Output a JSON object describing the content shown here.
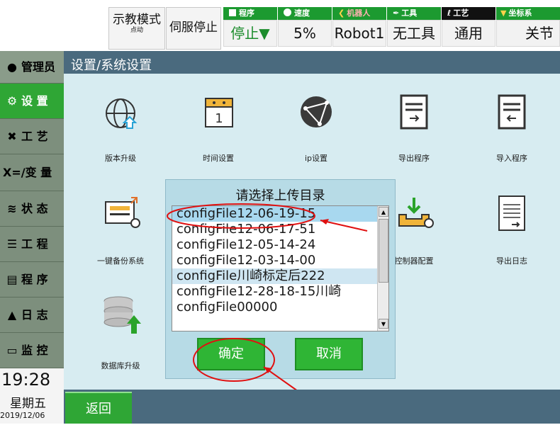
{
  "topbar": {
    "mode": {
      "label": "示教模式",
      "sub": "点动"
    },
    "servo_label": "伺服停止",
    "status": [
      {
        "header": "程序",
        "value": "停止▼",
        "color": "#1c8c2c",
        "icon": "grid-icon"
      },
      {
        "header": "速度",
        "value": "5%",
        "color": "#111111",
        "icon": "speedometer-icon"
      },
      {
        "header": "机器人",
        "value": "Robot1",
        "color": "#2ba32b",
        "icon": "robot-arm-icon"
      },
      {
        "header": "工具",
        "value": "无工具",
        "color": "#1a1a1a",
        "icon": "wrench-icon"
      },
      {
        "header": "工艺",
        "value": "通用",
        "color": "#1a1a1a",
        "icon": "craft-icon"
      },
      {
        "header": "坐标系",
        "value": "关节",
        "color": "#1a1a1a",
        "icon": "coordinate-icon"
      }
    ]
  },
  "sidebar": {
    "items": [
      {
        "label": "管理员",
        "icon": "user-icon"
      },
      {
        "label": "设 置",
        "icon": "gear-icon"
      },
      {
        "label": "工 艺",
        "icon": "tools-icon"
      },
      {
        "label": "X=/变 量",
        "icon": ""
      },
      {
        "label": "状 态",
        "icon": "status-icon"
      },
      {
        "label": "工 程",
        "icon": "list-icon"
      },
      {
        "label": "程 序",
        "icon": "program-icon"
      },
      {
        "label": "日 志",
        "icon": "warning-icon"
      },
      {
        "label": "监 控",
        "icon": "monitor-icon"
      }
    ],
    "time": "19:28",
    "weekday": "星期五",
    "date": "2019/12/06"
  },
  "breadcrumb": "设置/系统设置",
  "tiles": [
    {
      "label": "版本升级",
      "icon": "globe-upgrade-icon"
    },
    {
      "label": "时间设置",
      "icon": "calendar-icon"
    },
    {
      "label": "ip设置",
      "icon": "network-icon"
    },
    {
      "label": "导出程序",
      "icon": "export-program-icon"
    },
    {
      "label": "导入程序",
      "icon": "import-program-icon"
    },
    {
      "label": "一键备份系统",
      "icon": "backup-icon"
    },
    {
      "label": "控制器配置",
      "icon": "controller-config-icon"
    },
    {
      "label": "导出日志",
      "icon": "export-log-icon"
    },
    {
      "label": "数据库升级",
      "icon": "database-upgrade-icon"
    }
  ],
  "dialog": {
    "title": "请选择上传目录",
    "items": [
      "configFile12-06-19-15",
      "configFile12-06-17-51",
      "configFile12-05-14-24",
      "configFile12-03-14-00",
      "configFile川崎标定后222",
      "configFile12-28-18-15川崎",
      "configFile00000"
    ],
    "selected_index": 0,
    "confirm_label": "确定",
    "cancel_label": "取消"
  },
  "bottom": {
    "back_label": "返回"
  },
  "colors": {
    "accent_green": "#2fa635",
    "header_bar": "#4a6a7e",
    "content_bg": "#d7ecf1",
    "annotation_red": "#e01010"
  }
}
